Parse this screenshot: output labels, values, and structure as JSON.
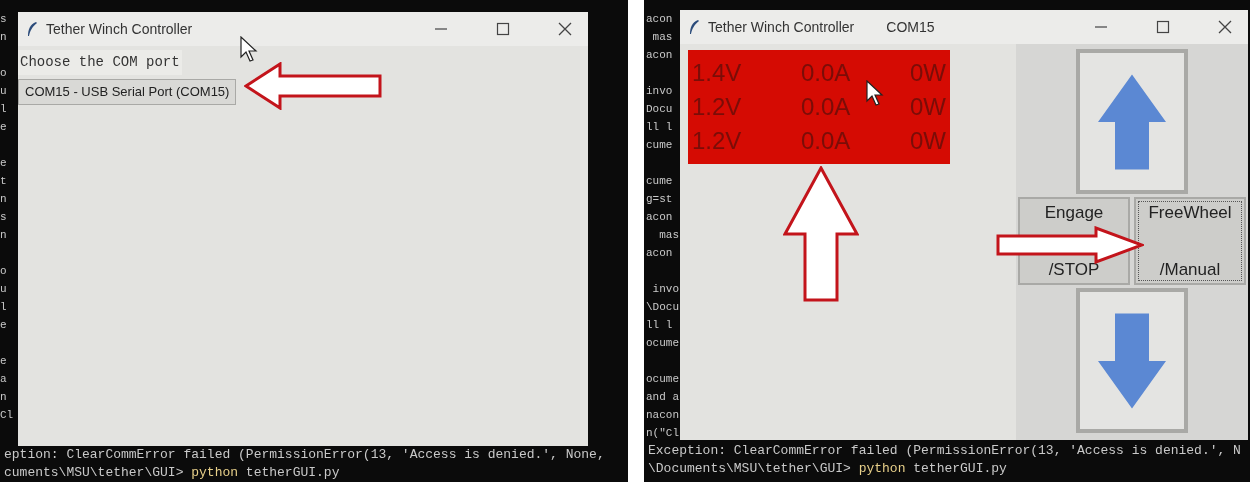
{
  "screens": [
    {
      "kind": "port_select",
      "terminal_fragments": [
        [
          "s",
          "n"
        ],
        [
          "o",
          "u",
          "l",
          "e"
        ],
        [
          "e",
          "t",
          "n",
          "s",
          "n"
        ],
        [
          "o",
          "u",
          "l",
          "e"
        ],
        [
          "e",
          "a",
          "n",
          "Cl"
        ]
      ],
      "window": {
        "title": "Tether Winch Controller",
        "prompt": "Choose the COM port",
        "port_button": "COM15 - USB Serial Port (COM15)"
      },
      "terminal_lines": [
        {
          "text": "eption: ClearCommError failed (PermissionError(13, 'Access is denied.', None,"
        },
        {
          "text": "cuments\\MSU\\tether\\GUI> ",
          "command": "python tetherGUI.py"
        }
      ]
    },
    {
      "kind": "controller",
      "terminal_fragments": [
        [
          "acon",
          " mas",
          "acon"
        ],
        [
          "invo",
          "Docu",
          "ll l",
          "cume"
        ],
        [
          "cume",
          "g=st",
          "acon",
          "  mas",
          "acon"
        ],
        [
          " invo",
          "\\Docu",
          "ll l",
          "ocume"
        ],
        [
          "ocume",
          "and a",
          "nacon",
          "n(\"Cl"
        ]
      ],
      "window": {
        "title": "Tether Winch Controller",
        "port": "COM15",
        "readings": [
          [
            "1.4V",
            "0.0A",
            "0W"
          ],
          [
            "1.2V",
            "0.0A",
            "0W"
          ],
          [
            "1.2V",
            "0.0A",
            "0W"
          ]
        ],
        "mode_buttons": [
          {
            "lines": [
              "Engage",
              "/STOP"
            ],
            "focused": false
          },
          {
            "lines": [
              "FreeWheel",
              "/Manual"
            ],
            "focused": true
          }
        ]
      },
      "terminal_lines": [
        {
          "text": "Exception: ClearCommError failed (PermissionError(13, 'Access is denied.', N"
        },
        {
          "text": "\\Documents\\MSU\\tether\\GUI> ",
          "command": "python tetherGUI.py"
        }
      ]
    }
  ]
}
